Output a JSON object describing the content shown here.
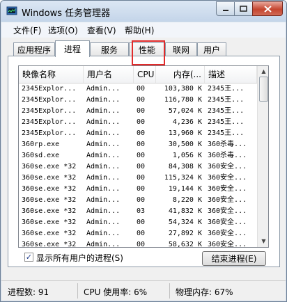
{
  "window": {
    "title": "Windows 任务管理器"
  },
  "menu": [
    "文件(F)",
    "选项(O)",
    "查看(V)",
    "帮助(H)"
  ],
  "tabs": [
    "应用程序",
    "进程",
    "服务",
    "性能",
    "联网",
    "用户"
  ],
  "active_tab": "进程",
  "columns": [
    "映像名称",
    "用户名",
    "CPU",
    "内存(...",
    "描述"
  ],
  "processes": [
    [
      "2345Explor...",
      "Admin...",
      "00",
      "103,380 K",
      "2345王..."
    ],
    [
      "2345Explor...",
      "Admin...",
      "00",
      "116,780 K",
      "2345王..."
    ],
    [
      "2345Explor...",
      "Admin...",
      "00",
      "57,024 K",
      "2345王..."
    ],
    [
      "2345Explor...",
      "Admin...",
      "00",
      "4,236 K",
      "2345王..."
    ],
    [
      "2345Explor...",
      "Admin...",
      "00",
      "13,960 K",
      "2345王..."
    ],
    [
      "360rp.exe",
      "Admin...",
      "00",
      "30,500 K",
      "360杀毒..."
    ],
    [
      "360sd.exe",
      "Admin...",
      "00",
      "1,056 K",
      "360杀毒..."
    ],
    [
      "360se.exe *32",
      "Admin...",
      "00",
      "84,308 K",
      "360安全..."
    ],
    [
      "360se.exe *32",
      "Admin...",
      "00",
      "115,324 K",
      "360安全..."
    ],
    [
      "360se.exe *32",
      "Admin...",
      "00",
      "19,144 K",
      "360安全..."
    ],
    [
      "360se.exe *32",
      "Admin...",
      "00",
      "8,220 K",
      "360安全..."
    ],
    [
      "360se.exe *32",
      "Admin...",
      "03",
      "41,832 K",
      "360安全..."
    ],
    [
      "360se.exe *32",
      "Admin...",
      "00",
      "54,324 K",
      "360安全..."
    ],
    [
      "360se.exe *32",
      "Admin...",
      "00",
      "27,892 K",
      "360安全..."
    ],
    [
      "360se.exe *32",
      "Admin...",
      "00",
      "58,632 K",
      "360安全..."
    ]
  ],
  "show_all_label": "显示所有用户的进程(S)",
  "show_all_checked": true,
  "end_process_label": "结束进程(E)",
  "status": {
    "processes": "进程数: 91",
    "cpu": "CPU 使用率: 6%",
    "memory": "物理内存: 67%"
  },
  "colors": {
    "highlight": "#e12b2b",
    "titlebar": "#c4d5e9",
    "close": "#c5452f"
  }
}
